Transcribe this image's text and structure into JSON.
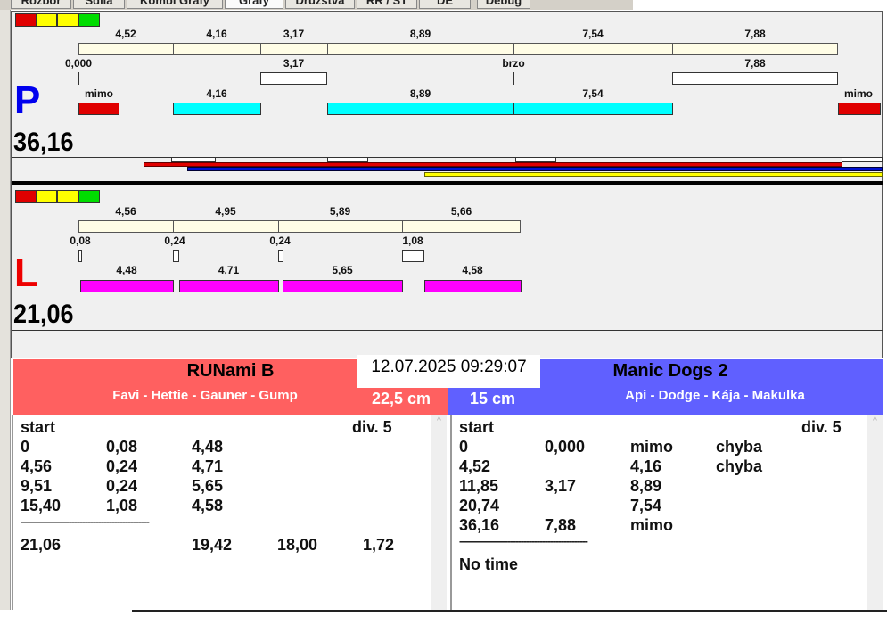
{
  "tabs": [
    "Rozbor",
    "Sdíla",
    "Kombi Grafy",
    "Grafy",
    "Družstva",
    "RR / ST",
    "DE",
    "Debug"
  ],
  "colors": {
    "red": "#e00000",
    "yellow": "#ffff00",
    "green": "#00dd00",
    "cyan": "#00ffff",
    "magenta": "#ff00ff",
    "team_red": "#ff6060",
    "team_blue": "#6060ff"
  },
  "p": {
    "letter": "P",
    "total": "36,16",
    "row1": [
      "4,52",
      "4,16",
      "3,17",
      "8,89",
      "7,54",
      "7,88"
    ],
    "row2": [
      "0,000",
      "3,17",
      "brzo",
      "7,88"
    ],
    "row3": [
      "mimo",
      "4,16",
      "8,89",
      "7,54",
      "mimo"
    ]
  },
  "l": {
    "letter": "L",
    "total": "21,06",
    "row1": [
      "4,56",
      "4,95",
      "5,89",
      "5,66"
    ],
    "row2": [
      "0,08",
      "0,24",
      "0,24",
      "1,08"
    ],
    "row3": [
      "4,48",
      "4,71",
      "5,65",
      "4,58"
    ]
  },
  "timestamp": "12.07.2025 09:29:07",
  "left_team": {
    "name": "RUNami B",
    "members": "Favi - Hettie - Gauner - Gump",
    "height": "22,5 cm",
    "start": "start",
    "div": "div.  5",
    "rows": [
      [
        "0",
        "0,08",
        "4,48"
      ],
      [
        "4,56",
        "0,24",
        "4,71"
      ],
      [
        "9,51",
        "0,24",
        "5,65"
      ],
      [
        "15,40",
        "1,08",
        "4,58"
      ]
    ],
    "separator": "------------------------------------------------",
    "summary": [
      "21,06",
      "19,42",
      "18,00",
      "1,72"
    ]
  },
  "right_team": {
    "name": "Manic Dogs 2",
    "members": "Api - Dodge - Kája - Makulka",
    "height": "15 cm",
    "start": "start",
    "div": "div.  5",
    "rows": [
      [
        "0",
        "0,000",
        "mimo",
        "chyba"
      ],
      [
        "4,52",
        "",
        "4,16",
        "chyba"
      ],
      [
        "11,85",
        "3,17",
        "8,89",
        ""
      ],
      [
        "20,74",
        "",
        "7,54",
        ""
      ],
      [
        "36,16",
        "7,88",
        "mimo",
        ""
      ]
    ],
    "separator": "------------------------------------------------",
    "footer": "No time"
  }
}
